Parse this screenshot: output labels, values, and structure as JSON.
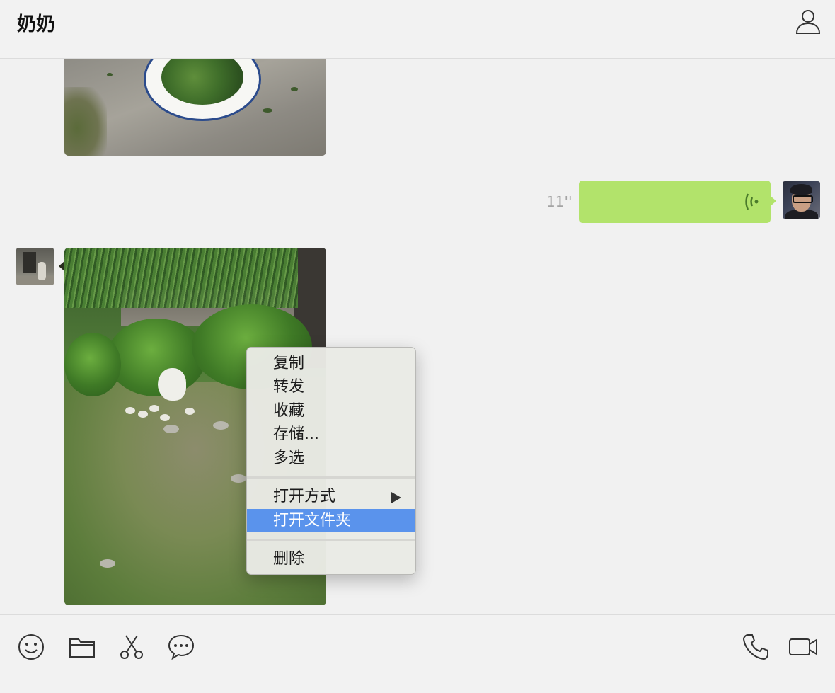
{
  "header": {
    "title": "奶奶",
    "profile_icon": "person-icon"
  },
  "messages": [
    {
      "type": "image",
      "sender": "contact",
      "description_icon": "image-thumbnail"
    },
    {
      "type": "voice",
      "sender": "self",
      "duration": "11''"
    },
    {
      "type": "image",
      "sender": "contact",
      "description_icon": "image-thumbnail"
    }
  ],
  "context_menu": {
    "items": [
      {
        "label": "复制"
      },
      {
        "label": "转发"
      },
      {
        "label": "收藏"
      },
      {
        "label": "存储..."
      },
      {
        "label": "多选"
      },
      {
        "label": "打开方式",
        "has_submenu": true
      },
      {
        "label": "打开文件夹",
        "active": true
      },
      {
        "label": "删除"
      }
    ],
    "highlight_color": "#5a93ec"
  },
  "toolbar": {
    "left_icons": [
      "emoji-icon",
      "folder-icon",
      "scissors-icon",
      "chat-bubble-icon"
    ],
    "right_icons": [
      "phone-icon",
      "video-camera-icon"
    ]
  },
  "colors": {
    "voice_bubble": "#b2e36b",
    "background": "#f1f1f1"
  }
}
